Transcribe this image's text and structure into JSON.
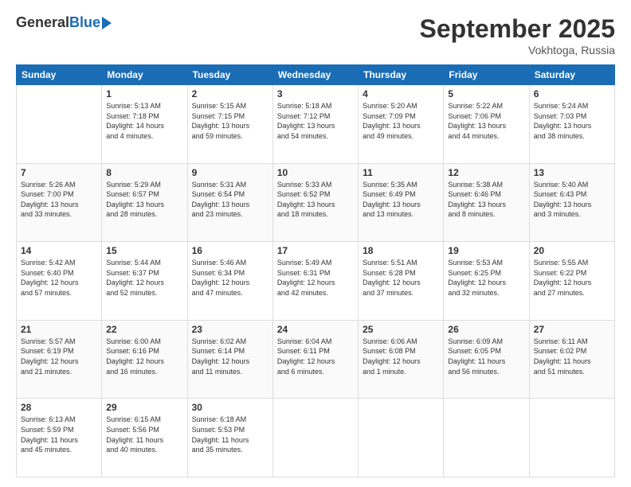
{
  "header": {
    "logo_general": "General",
    "logo_blue": "Blue",
    "title": "September 2025",
    "location": "Vokhtoga, Russia"
  },
  "days_of_week": [
    "Sunday",
    "Monday",
    "Tuesday",
    "Wednesday",
    "Thursday",
    "Friday",
    "Saturday"
  ],
  "weeks": [
    [
      {
        "day": "",
        "info": ""
      },
      {
        "day": "1",
        "info": "Sunrise: 5:13 AM\nSunset: 7:18 PM\nDaylight: 14 hours\nand 4 minutes."
      },
      {
        "day": "2",
        "info": "Sunrise: 5:15 AM\nSunset: 7:15 PM\nDaylight: 13 hours\nand 59 minutes."
      },
      {
        "day": "3",
        "info": "Sunrise: 5:18 AM\nSunset: 7:12 PM\nDaylight: 13 hours\nand 54 minutes."
      },
      {
        "day": "4",
        "info": "Sunrise: 5:20 AM\nSunset: 7:09 PM\nDaylight: 13 hours\nand 49 minutes."
      },
      {
        "day": "5",
        "info": "Sunrise: 5:22 AM\nSunset: 7:06 PM\nDaylight: 13 hours\nand 44 minutes."
      },
      {
        "day": "6",
        "info": "Sunrise: 5:24 AM\nSunset: 7:03 PM\nDaylight: 13 hours\nand 38 minutes."
      }
    ],
    [
      {
        "day": "7",
        "info": "Sunrise: 5:26 AM\nSunset: 7:00 PM\nDaylight: 13 hours\nand 33 minutes."
      },
      {
        "day": "8",
        "info": "Sunrise: 5:29 AM\nSunset: 6:57 PM\nDaylight: 13 hours\nand 28 minutes."
      },
      {
        "day": "9",
        "info": "Sunrise: 5:31 AM\nSunset: 6:54 PM\nDaylight: 13 hours\nand 23 minutes."
      },
      {
        "day": "10",
        "info": "Sunrise: 5:33 AM\nSunset: 6:52 PM\nDaylight: 13 hours\nand 18 minutes."
      },
      {
        "day": "11",
        "info": "Sunrise: 5:35 AM\nSunset: 6:49 PM\nDaylight: 13 hours\nand 13 minutes."
      },
      {
        "day": "12",
        "info": "Sunrise: 5:38 AM\nSunset: 6:46 PM\nDaylight: 13 hours\nand 8 minutes."
      },
      {
        "day": "13",
        "info": "Sunrise: 5:40 AM\nSunset: 6:43 PM\nDaylight: 13 hours\nand 3 minutes."
      }
    ],
    [
      {
        "day": "14",
        "info": "Sunrise: 5:42 AM\nSunset: 6:40 PM\nDaylight: 12 hours\nand 57 minutes."
      },
      {
        "day": "15",
        "info": "Sunrise: 5:44 AM\nSunset: 6:37 PM\nDaylight: 12 hours\nand 52 minutes."
      },
      {
        "day": "16",
        "info": "Sunrise: 5:46 AM\nSunset: 6:34 PM\nDaylight: 12 hours\nand 47 minutes."
      },
      {
        "day": "17",
        "info": "Sunrise: 5:49 AM\nSunset: 6:31 PM\nDaylight: 12 hours\nand 42 minutes."
      },
      {
        "day": "18",
        "info": "Sunrise: 5:51 AM\nSunset: 6:28 PM\nDaylight: 12 hours\nand 37 minutes."
      },
      {
        "day": "19",
        "info": "Sunrise: 5:53 AM\nSunset: 6:25 PM\nDaylight: 12 hours\nand 32 minutes."
      },
      {
        "day": "20",
        "info": "Sunrise: 5:55 AM\nSunset: 6:22 PM\nDaylight: 12 hours\nand 27 minutes."
      }
    ],
    [
      {
        "day": "21",
        "info": "Sunrise: 5:57 AM\nSunset: 6:19 PM\nDaylight: 12 hours\nand 21 minutes."
      },
      {
        "day": "22",
        "info": "Sunrise: 6:00 AM\nSunset: 6:16 PM\nDaylight: 12 hours\nand 16 minutes."
      },
      {
        "day": "23",
        "info": "Sunrise: 6:02 AM\nSunset: 6:14 PM\nDaylight: 12 hours\nand 11 minutes."
      },
      {
        "day": "24",
        "info": "Sunrise: 6:04 AM\nSunset: 6:11 PM\nDaylight: 12 hours\nand 6 minutes."
      },
      {
        "day": "25",
        "info": "Sunrise: 6:06 AM\nSunset: 6:08 PM\nDaylight: 12 hours\nand 1 minute."
      },
      {
        "day": "26",
        "info": "Sunrise: 6:09 AM\nSunset: 6:05 PM\nDaylight: 11 hours\nand 56 minutes."
      },
      {
        "day": "27",
        "info": "Sunrise: 6:11 AM\nSunset: 6:02 PM\nDaylight: 11 hours\nand 51 minutes."
      }
    ],
    [
      {
        "day": "28",
        "info": "Sunrise: 6:13 AM\nSunset: 5:59 PM\nDaylight: 11 hours\nand 45 minutes."
      },
      {
        "day": "29",
        "info": "Sunrise: 6:15 AM\nSunset: 5:56 PM\nDaylight: 11 hours\nand 40 minutes."
      },
      {
        "day": "30",
        "info": "Sunrise: 6:18 AM\nSunset: 5:53 PM\nDaylight: 11 hours\nand 35 minutes."
      },
      {
        "day": "",
        "info": ""
      },
      {
        "day": "",
        "info": ""
      },
      {
        "day": "",
        "info": ""
      },
      {
        "day": "",
        "info": ""
      }
    ]
  ]
}
